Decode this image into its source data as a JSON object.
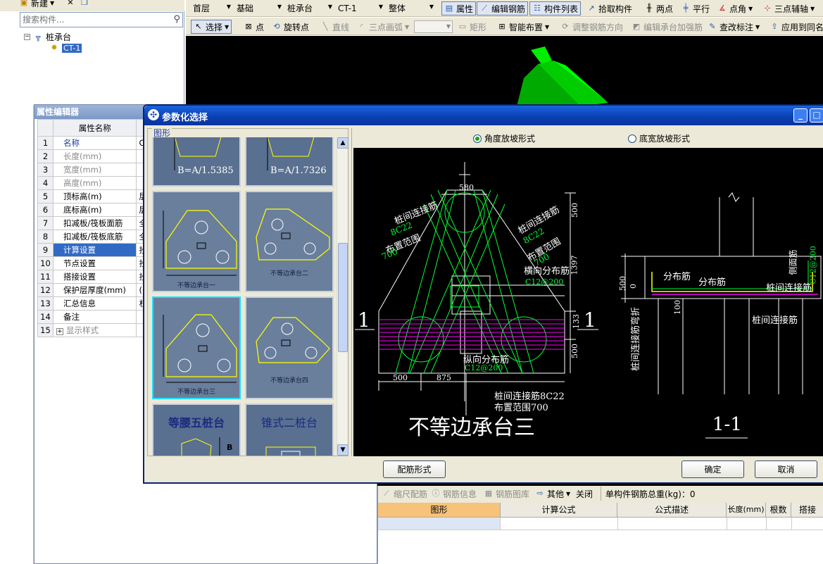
{
  "left_panel": {
    "new_label": "新建",
    "search_placeholder": "搜索构件...",
    "tree_root": "桩承台",
    "tree_child": "CT-1"
  },
  "top_toolbar": {
    "floor": "首层",
    "category": "基础",
    "type": "桩承台",
    "component": "CT-1",
    "scope": "整体",
    "btn_props": "属性",
    "btn_edit_rebar": "编辑钢筋",
    "btn_list": "构件列表",
    "btn_pick": "拾取构件",
    "btn_two_points": "两点",
    "btn_parallel": "平行",
    "btn_point_angle": "点角",
    "btn_three_point_aux": "三点辅轴"
  },
  "draw_toolbar": {
    "select": "选择",
    "point": "点",
    "rotate_point": "旋转点",
    "line": "直线",
    "arc": "三点画弧",
    "rect": "矩形",
    "smart_layout": "智能布置",
    "adjust_rebar_dir": "调整钢筋方向",
    "edit_reinforce": "编辑承台加强筋",
    "check_label": "查改标注",
    "apply_same": "应用到同名"
  },
  "property_editor": {
    "title": "属性编辑器",
    "col_name": "属性名称",
    "rows": [
      {
        "num": "1",
        "name": "名称",
        "value": "C"
      },
      {
        "num": "2",
        "name": "长度(mm)",
        "value": ""
      },
      {
        "num": "3",
        "name": "宽度(mm)",
        "value": ""
      },
      {
        "num": "4",
        "name": "高度(mm)",
        "value": ""
      },
      {
        "num": "5",
        "name": "顶标高(m)",
        "value": "层"
      },
      {
        "num": "6",
        "name": "底标高(m)",
        "value": "层"
      },
      {
        "num": "7",
        "name": "扣减板/筏板面筋",
        "value": "全"
      },
      {
        "num": "8",
        "name": "扣减板/筏板底筋",
        "value": "全"
      },
      {
        "num": "9",
        "name": "计算设置",
        "value": "抄"
      },
      {
        "num": "10",
        "name": "节点设置",
        "value": "抄"
      },
      {
        "num": "11",
        "name": "搭接设置",
        "value": "抄"
      },
      {
        "num": "12",
        "name": "保护层厚度(mm)",
        "value": "("
      },
      {
        "num": "13",
        "name": "汇总信息",
        "value": "杠"
      },
      {
        "num": "14",
        "name": "备注",
        "value": ""
      },
      {
        "num": "15",
        "name": "显示样式",
        "value": ""
      }
    ]
  },
  "dialog": {
    "title": "参数化选择",
    "group_label": "图形",
    "radio_angle": "角度放坡形式",
    "radio_width": "底宽放坡形式",
    "btn_rebar_form": "配筋形式",
    "btn_ok": "确定",
    "btn_cancel": "取消",
    "thumbs": {
      "t0": "B=A/1.5385",
      "t1": "B=A/1.7326",
      "t2": "不等边承台一",
      "t3": "不等边承台二",
      "t4": "不等边承台三",
      "t5": "不等边承台四",
      "t6": "等腰五桩台",
      "t7": "锥式二桩台"
    },
    "drawing": {
      "title": "不等边承台三",
      "section_mark": "1",
      "section_title": "1-1",
      "d580": "580",
      "d500a": "500",
      "d1397": "1397",
      "d133": "133",
      "d500b": "500",
      "d500c": "500",
      "d875": "875",
      "lbl_link_rebar_l": "桩间连接筋",
      "lbl_8c22_l": "8C22",
      "lbl_range_l": "布置范围",
      "lbl_700_l": "700",
      "lbl_link_rebar_r": "桩间连接筋",
      "lbl_8c22_r": "8C22",
      "lbl_range_r": "布置范围",
      "lbl_700_r": "700",
      "lbl_horiz": "横向分布筋",
      "lbl_c12_h": "C12@200",
      "lbl_vert": "纵向分布筋",
      "lbl_c12_v": "C12@200",
      "lbl_link_b": "桩间连接筋8C22",
      "lbl_range_b": "布置范围700",
      "sec_dist1": "分布筋",
      "sec_dist2": "分布筋",
      "sec_link": "桩间连接筋",
      "sec_link2": "桩间连接筋",
      "sec_side": "侧面筋",
      "sec_side_v": "C12@200",
      "sec_bend": "桩间连接筋弯折",
      "sec_500": "500",
      "sec_0": "0",
      "sec_100": "100"
    }
  },
  "bottom_panel": {
    "scale_rebar": "缩尺配筋",
    "rebar_info": "钢筋信息",
    "rebar_lib": "钢筋图库",
    "other": "其他",
    "close": "关闭",
    "total_weight": "单构件钢筋总重(kg)：0",
    "columns": [
      "图形",
      "计算公式",
      "公式描述",
      "长度(mm)",
      "根数",
      "搭接"
    ]
  },
  "colors": {
    "dialog_title": "#0a246a",
    "drawing_bg": "#000000",
    "rebar_green": "#00ff33",
    "magenta": "#ff00ff",
    "highlight": "#316ac5"
  }
}
